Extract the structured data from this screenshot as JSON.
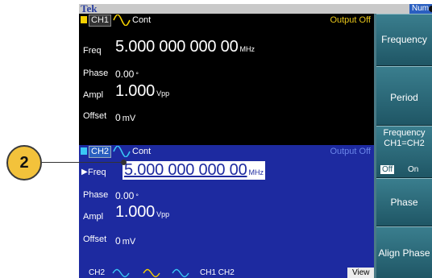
{
  "topbar": {
    "brand": "Tek",
    "indicator": "Num"
  },
  "ch1": {
    "label": "CH1",
    "mode": "Cont",
    "output": "Output Off",
    "rows": {
      "freq": {
        "label": "Freq",
        "value": "5.000 000 000 00",
        "unit": "MHz"
      },
      "phase": {
        "label": "Phase",
        "value": "0.00",
        "unit": "°"
      },
      "ampl": {
        "label": "Ampl",
        "value": "1.000",
        "unit": "Vpp"
      },
      "offset": {
        "label": "Offset",
        "value": "0",
        "unit": "mV"
      }
    }
  },
  "ch2": {
    "label": "CH2",
    "mode": "Cont",
    "output": "Output Off",
    "rows": {
      "freq": {
        "label": "Freq",
        "value": "5.000 000 000 00",
        "unit": "MHz"
      },
      "phase": {
        "label": "Phase",
        "value": "0.00",
        "unit": "°"
      },
      "ampl": {
        "label": "Ampl",
        "value": "1.000",
        "unit": "Vpp"
      },
      "offset": {
        "label": "Offset",
        "value": "0",
        "unit": "mV"
      }
    }
  },
  "bottom": {
    "tab_ch2": "CH2",
    "tab_ch1_ch2": "CH1  CH2",
    "view": "View"
  },
  "softkeys": {
    "frequency": "Frequency",
    "period": "Period",
    "freq_sync_line1": "Frequency",
    "freq_sync_line2": "CH1=CH2",
    "toggle_off": "Off",
    "toggle_on": "On",
    "phase": "Phase",
    "align_phase": "Align Phase"
  },
  "callout": {
    "number": "2"
  },
  "colors": {
    "ch1_marker": "#f5d000",
    "ch2_marker": "#39c6f5",
    "ch2_panel": "#1d2aa0",
    "softkey": "#2d6b7a",
    "callout": "#f3c23b"
  }
}
